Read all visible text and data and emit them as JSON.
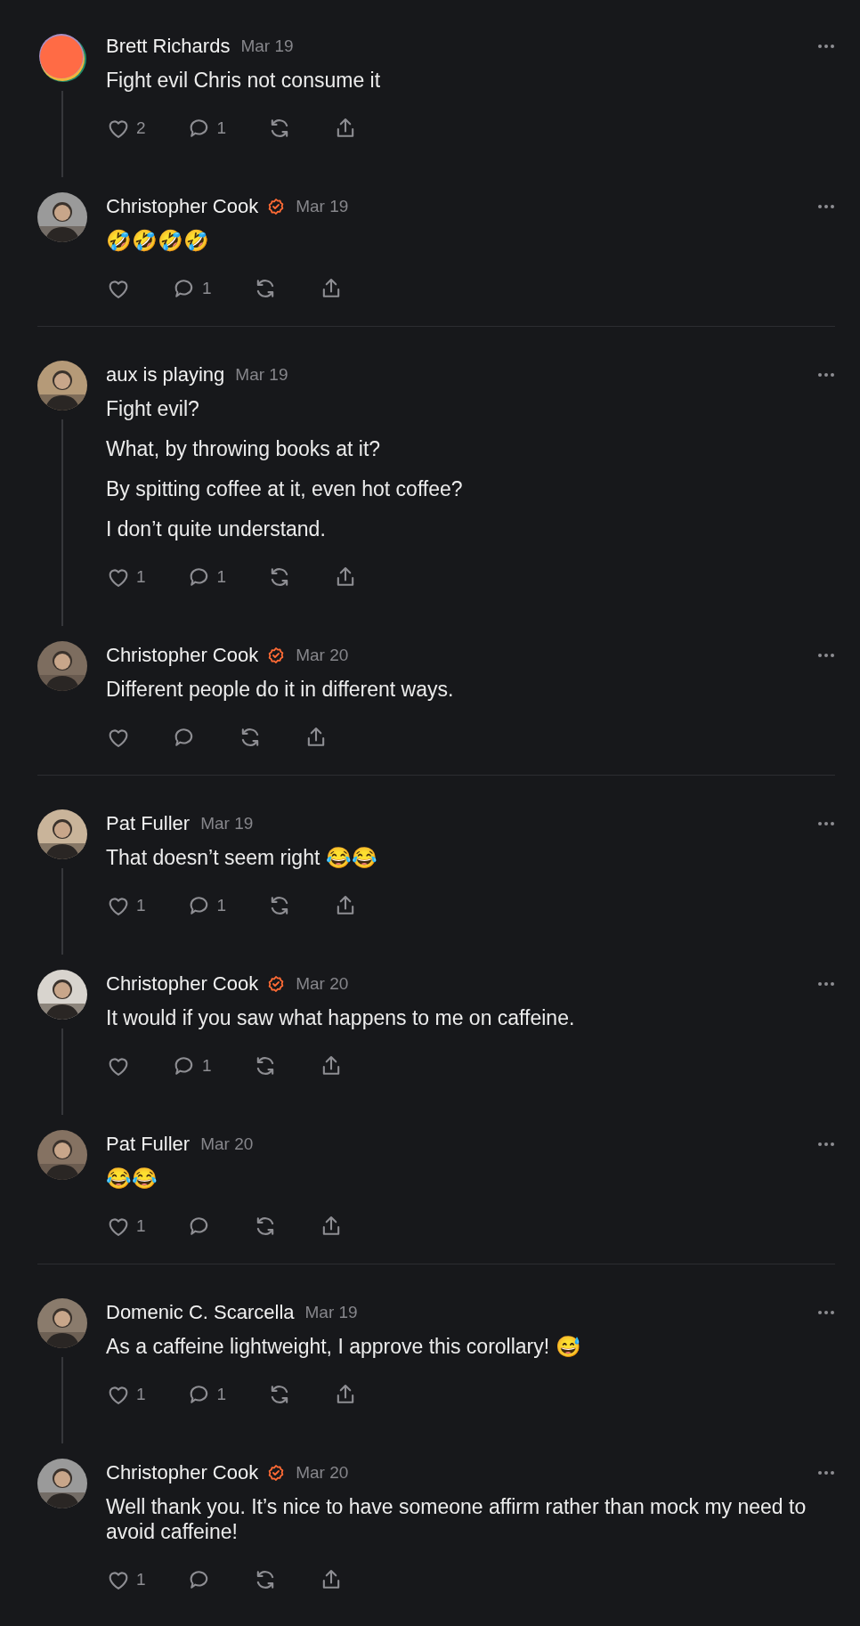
{
  "threads": [
    {
      "comments": [
        {
          "author": "Brett Richards",
          "verified": false,
          "date": "Mar 19",
          "avatar": {
            "kind": "logo"
          },
          "paragraphs": [
            "Fight evil Chris not consume it"
          ],
          "likes": "2",
          "replies": "1"
        },
        {
          "author": "Christopher Cook",
          "verified": true,
          "date": "Mar 19",
          "avatar": {
            "kind": "picture"
          },
          "paragraphs": [
            "🤣🤣🤣🤣"
          ],
          "replies": "1"
        }
      ]
    },
    {
      "comments": [
        {
          "author": "aux is playing",
          "verified": false,
          "date": "Mar 19",
          "avatar": {
            "kind": "picture"
          },
          "paragraphs": [
            "Fight evil?",
            "What, by throwing books at it?",
            "By spitting coffee at it, even hot coffee?",
            "I don’t quite understand."
          ],
          "likes": "1",
          "replies": "1"
        },
        {
          "author": "Christopher Cook",
          "verified": true,
          "date": "Mar 20",
          "avatar": {
            "kind": "picture"
          },
          "paragraphs": [
            "Different people do it in different ways."
          ]
        }
      ]
    },
    {
      "comments": [
        {
          "author": "Pat Fuller",
          "verified": false,
          "date": "Mar 19",
          "avatar": {
            "kind": "picture"
          },
          "paragraphs": [
            "That doesn’t seem right 😂😂"
          ],
          "likes": "1",
          "replies": "1"
        },
        {
          "author": "Christopher Cook",
          "verified": true,
          "date": "Mar 20",
          "avatar": {
            "kind": "picture"
          },
          "paragraphs": [
            "It would if you saw what happens to me on caffeine."
          ],
          "replies": "1"
        },
        {
          "author": "Pat Fuller",
          "verified": false,
          "date": "Mar 20",
          "avatar": {
            "kind": "picture"
          },
          "paragraphs": [
            "😂😂"
          ],
          "likes": "1"
        }
      ]
    },
    {
      "comments": [
        {
          "author": "Domenic C. Scarcella",
          "verified": false,
          "date": "Mar 19",
          "avatar": {
            "kind": "picture"
          },
          "paragraphs": [
            "As a caffeine lightweight, I approve this corollary! 😅"
          ],
          "likes": "1",
          "replies": "1"
        },
        {
          "author": "Christopher Cook",
          "verified": true,
          "date": "Mar 20",
          "avatar": {
            "kind": "picture"
          },
          "paragraphs": [
            "Well thank you. It’s nice to have someone affirm rather than mock my need to avoid caffeine!"
          ],
          "likes": "1"
        }
      ]
    }
  ]
}
